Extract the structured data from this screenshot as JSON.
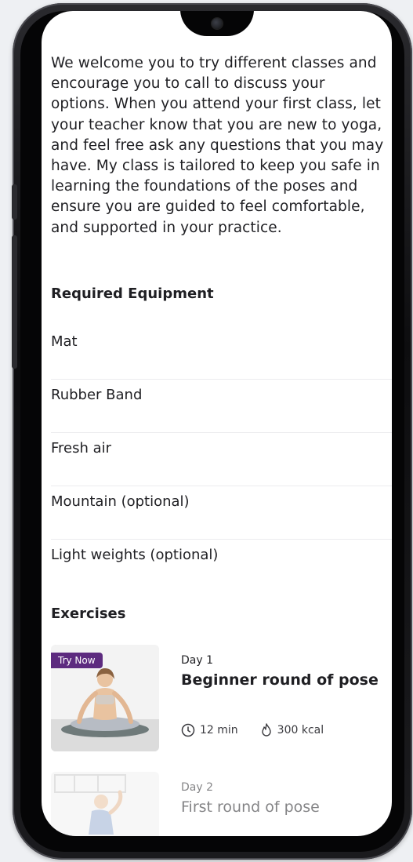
{
  "intro_text": "We welcome you to try different classes and encourage you to call to discuss your options. When you attend your first class, let your teacher know that you are new to yoga, and feel free ask any questions that you may have. My class is tailored to keep you safe in learning the foundations of the poses and ensure you are guided to feel comfortable, and supported in your practice.",
  "equipment": {
    "title": "Required Equipment",
    "items": [
      "Mat",
      "Rubber Band",
      "Fresh air",
      "Mountain (optional)",
      "Light weights (optional)"
    ]
  },
  "exercises": {
    "title": "Exercises",
    "items": [
      {
        "badge": "Try Now",
        "day": "Day 1",
        "title": "Beginner round of pose",
        "duration": "12 min",
        "calories": "300 kcal"
      },
      {
        "day": "Day 2",
        "title": "First round of pose"
      }
    ]
  },
  "icons": {
    "duration": "clock-icon",
    "calories": "flame-icon"
  },
  "colors": {
    "badge": "#5d2b7f",
    "text": "#1f1f23",
    "divider": "#ececef"
  }
}
